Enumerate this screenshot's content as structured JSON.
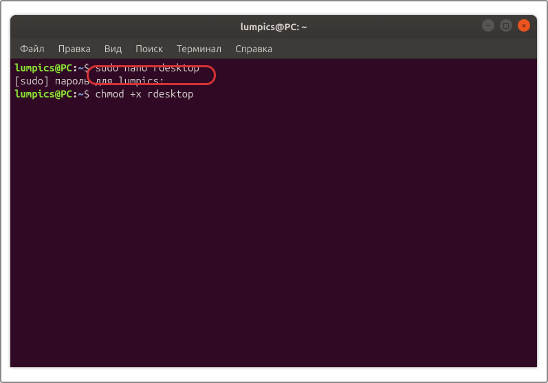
{
  "window": {
    "title": "lumpics@PC: ~"
  },
  "menu": {
    "file": "Файл",
    "edit": "Правка",
    "view": "Вид",
    "search": "Поиск",
    "terminal": "Терминал",
    "help": "Справка"
  },
  "terminal": {
    "lines": [
      {
        "user": "lumpics@PC",
        "colon": ":",
        "path": "~",
        "dollar": "$ ",
        "cmd": "sudo nano rdesktop"
      },
      {
        "text": "[sudo] пароль для lumpics:"
      },
      {
        "user": "lumpics@PC",
        "colon": ":",
        "path": "~",
        "dollar": "$ ",
        "cmd": "chmod +x rdesktop"
      }
    ]
  },
  "icons": {
    "minimize": "–",
    "maximize": "◻",
    "close": "×"
  }
}
